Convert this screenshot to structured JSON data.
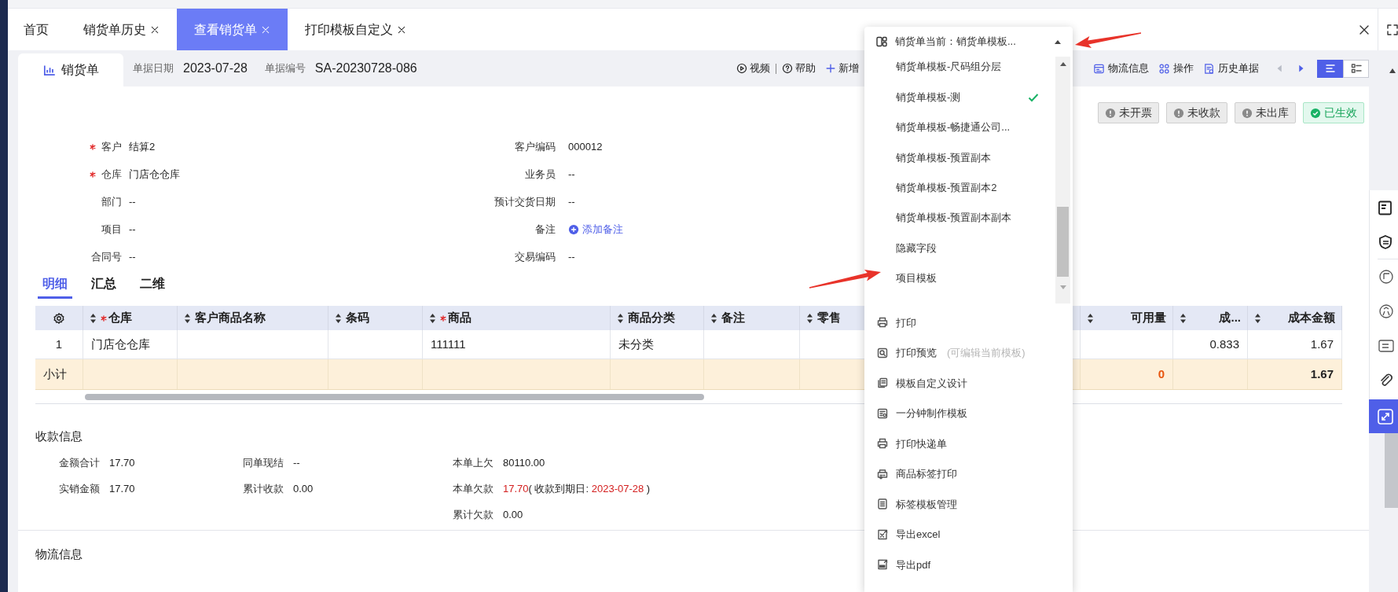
{
  "tabs": [
    {
      "label": "首页",
      "closable": false,
      "selected": false
    },
    {
      "label": "销货单历史",
      "closable": true,
      "selected": false
    },
    {
      "label": "查看销货单",
      "closable": true,
      "selected": true
    },
    {
      "label": "打印模板自定义",
      "closable": true,
      "selected": false
    }
  ],
  "document": {
    "title": "销货单",
    "meta": [
      {
        "label": "单据日期",
        "value": "2023-07-28"
      },
      {
        "label": "单据编号",
        "value": "SA-20230728-086"
      }
    ]
  },
  "toolbar_left": [
    {
      "label": "视频",
      "kind": "video"
    },
    {
      "label": "帮助",
      "kind": "help"
    },
    {
      "label": "新增",
      "kind": "add"
    }
  ],
  "toolbar_right": [
    {
      "label": "物流信息",
      "kind": "logistics"
    },
    {
      "label": "操作",
      "kind": "operate"
    },
    {
      "label": "历史单据",
      "kind": "history"
    }
  ],
  "pager": [
    {
      "kind": "prev",
      "disabled": true
    },
    {
      "kind": "next",
      "disabled": false
    }
  ],
  "view_modes": [
    {
      "kind": "list",
      "selected": true
    },
    {
      "kind": "detail",
      "selected": false
    }
  ],
  "status_badges": [
    {
      "label": "未开票",
      "kind": "pending"
    },
    {
      "label": "未收款",
      "kind": "pending"
    },
    {
      "label": "未出库",
      "kind": "pending"
    },
    {
      "label": "已生效",
      "kind": "done"
    }
  ],
  "form_rows": [
    {
      "left": {
        "label": "客户",
        "required": true,
        "value": "结算2"
      },
      "right": {
        "label": "客户编码",
        "kind": "text",
        "value": "000012"
      }
    },
    {
      "left": {
        "label": "仓库",
        "required": true,
        "value": "门店仓仓库"
      },
      "right": {
        "label": "业务员",
        "kind": "text",
        "value": "--"
      }
    },
    {
      "left": {
        "label": "部门",
        "required": false,
        "value": "--"
      },
      "right": {
        "label": "预计交货日期",
        "kind": "text",
        "value": "--"
      }
    },
    {
      "left": {
        "label": "项目",
        "required": false,
        "value": "--"
      },
      "right": {
        "label": "备注",
        "kind": "link",
        "value": "添加备注"
      }
    },
    {
      "left": {
        "label": "合同号",
        "required": false,
        "value": "--"
      },
      "right": {
        "label": "交易编码",
        "kind": "text",
        "value": "--"
      }
    }
  ],
  "detail_tabs": [
    {
      "label": "明细",
      "selected": true
    },
    {
      "label": "汇总",
      "selected": false
    },
    {
      "label": "二维",
      "selected": false
    }
  ],
  "table": {
    "columns": [
      {
        "kind": "settings"
      },
      {
        "label": "仓库",
        "required": true,
        "kind": "text"
      },
      {
        "label": "客户商品名称",
        "required": false,
        "kind": "text"
      },
      {
        "label": "条码",
        "required": false,
        "kind": "text"
      },
      {
        "label": "商品",
        "required": true,
        "kind": "text"
      },
      {
        "label": "商品分类",
        "required": false,
        "kind": "text"
      },
      {
        "label": "备注",
        "required": false,
        "kind": "text"
      },
      {
        "label": "零售",
        "required": false,
        "kind": "text"
      },
      {
        "label": "可用量",
        "required": false,
        "kind": "number"
      },
      {
        "label": "成...",
        "required": false,
        "kind": "number"
      },
      {
        "label": "成本金额",
        "required": false,
        "kind": "number"
      }
    ],
    "rows": [
      {
        "kind": "item",
        "cells": [
          "1",
          "门店仓仓库",
          null,
          null,
          "111111",
          "未分类",
          null,
          null,
          null,
          "0.833",
          "1.67"
        ]
      },
      {
        "kind": "subtotal",
        "cells": [
          {
            "text": "小计",
            "alert": false
          },
          null,
          null,
          null,
          null,
          null,
          null,
          null,
          {
            "text": "0",
            "alert": true
          },
          null,
          {
            "text": "1.67",
            "alert": false
          }
        ]
      }
    ]
  },
  "payment": {
    "title": "收款信息",
    "columns": [
      [
        {
          "label": "金额合计",
          "value": [
            {
              "text": "17.70",
              "alert": false
            }
          ]
        },
        {
          "label": "实销金额",
          "value": [
            {
              "text": "17.70",
              "alert": false
            }
          ]
        }
      ],
      [
        {
          "label": "同单现结",
          "value": [
            {
              "text": "--",
              "alert": false
            }
          ]
        },
        {
          "label": "累计收款",
          "value": [
            {
              "text": "0.00",
              "alert": false
            }
          ]
        }
      ],
      [
        {
          "label": "本单上欠",
          "value": [
            {
              "text": "80110.00",
              "alert": false
            }
          ]
        },
        {
          "label": "本单欠款",
          "value": [
            {
              "text": "17.70",
              "alert": true
            },
            {
              "text": "( 收款到期日: ",
              "alert": false
            },
            {
              "text": "2023-07-28",
              "alert": true
            },
            {
              "text": " )",
              "alert": false
            }
          ]
        },
        {
          "label": "累计欠款",
          "value": [
            {
              "text": "0.00",
              "alert": false
            }
          ]
        }
      ]
    ]
  },
  "logistics": {
    "title": "物流信息"
  },
  "template_menu": {
    "header": "销货单当前：销货单模板...",
    "expanded": true,
    "templates": [
      {
        "label": "销货单模板-尺码组分层",
        "selected": false
      },
      {
        "label": "销货单模板-测",
        "selected": true
      },
      {
        "label": "销货单模板-畅捷通公司...",
        "selected": false
      },
      {
        "label": "销货单模板-预置副本",
        "selected": false
      },
      {
        "label": "销货单模板-预置副本2",
        "selected": false
      },
      {
        "label": "销货单模板-预置副本副本",
        "selected": false
      },
      {
        "label": "隐藏字段",
        "selected": false
      },
      {
        "label": "项目模板",
        "selected": false
      }
    ],
    "actions": [
      {
        "label": "打印",
        "kind": "print"
      },
      {
        "label": "打印预览",
        "kind": "preview",
        "hint": "(可编辑当前模板)"
      },
      {
        "label": "模板自定义设计",
        "kind": "design"
      },
      {
        "label": "一分钟制作模板",
        "kind": "quick"
      },
      {
        "label": "打印快递单",
        "kind": "express"
      },
      {
        "label": "商品标签打印",
        "kind": "label_print"
      },
      {
        "label": "标签模板管理",
        "kind": "label_manage"
      },
      {
        "label": "导出excel",
        "kind": "excel"
      },
      {
        "label": "导出pdf",
        "kind": "pdf"
      }
    ]
  }
}
